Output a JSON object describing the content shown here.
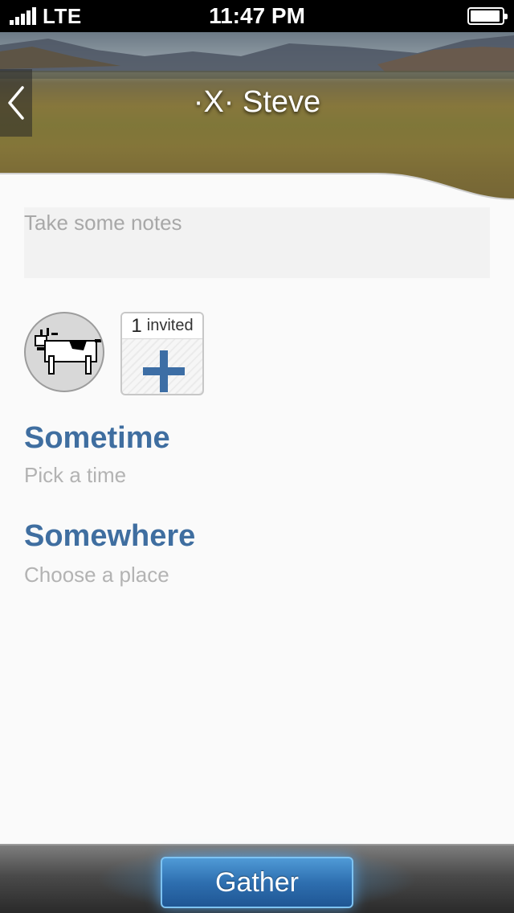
{
  "status_bar": {
    "carrier": "LTE",
    "time": "11:47 PM",
    "signal_icon": "signal-bars-icon",
    "battery_icon": "battery-icon"
  },
  "header": {
    "title": "·X· Steve",
    "back_icon": "chevron-left-icon"
  },
  "notes": {
    "placeholder": "Take some notes",
    "value": ""
  },
  "invitees": {
    "count": "1",
    "label": "invited",
    "add_icon": "plus-icon",
    "avatar_icon": "dogcow-avatar"
  },
  "time_section": {
    "title": "Sometime",
    "subtitle": "Pick a time"
  },
  "place_section": {
    "title": "Somewhere",
    "subtitle": "Choose a place"
  },
  "footer": {
    "button_label": "Gather"
  },
  "colors": {
    "accent": "#3f6ea0",
    "button": "#2e6fb0",
    "muted_text": "#b3b3b3"
  }
}
